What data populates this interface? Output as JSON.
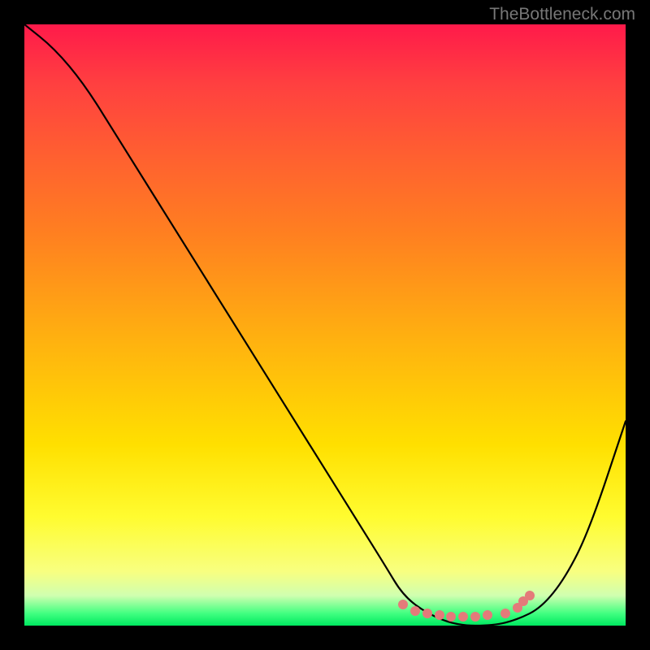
{
  "watermark": "TheBottleneck.com",
  "chart_data": {
    "type": "line",
    "title": "",
    "xlabel": "",
    "ylabel": "",
    "xlim": [
      0,
      100
    ],
    "ylim": [
      0,
      100
    ],
    "series": [
      {
        "name": "curve",
        "x": [
          0,
          5,
          10,
          15,
          20,
          25,
          30,
          35,
          40,
          45,
          50,
          55,
          60,
          63,
          67,
          72,
          78,
          82,
          86,
          90,
          94,
          100
        ],
        "y": [
          100,
          96,
          90,
          82,
          74,
          66,
          58,
          50,
          42,
          34,
          26,
          18,
          10,
          5,
          2,
          0,
          0,
          1,
          3,
          8,
          16,
          34
        ]
      }
    ],
    "annotations": {
      "dots_x": [
        63,
        65,
        67,
        69,
        71,
        73,
        75,
        77,
        80,
        82,
        83,
        84
      ],
      "dots_y": [
        3.5,
        2.5,
        2,
        1.7,
        1.5,
        1.5,
        1.5,
        1.7,
        2,
        3,
        4,
        5
      ]
    },
    "background_gradient": {
      "top": "#ff1a4a",
      "mid_upper": "#ff8020",
      "mid": "#ffe000",
      "lower": "#40ff80",
      "bottom": "#00e860"
    }
  }
}
